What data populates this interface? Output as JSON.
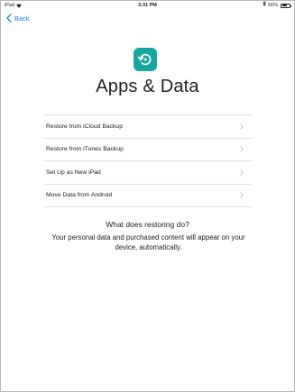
{
  "status_bar": {
    "device": "iPad",
    "time": "3:31 PM",
    "battery_percent": "56%",
    "battery_level": 0.56
  },
  "nav": {
    "back_label": "Back",
    "accent_color": "#147efb"
  },
  "header": {
    "icon": "restore-arrow-icon",
    "icon_color": "#1aa6a0",
    "title": "Apps & Data"
  },
  "options": [
    {
      "label": "Restore from iCloud Backup"
    },
    {
      "label": "Restore from iTunes Backup"
    },
    {
      "label": "Set Up as New iPad"
    },
    {
      "label": "Move Data from Android"
    }
  ],
  "info": {
    "heading": "What does restoring do?",
    "body": "Your personal data and purchased content will appear on your device, automatically."
  }
}
